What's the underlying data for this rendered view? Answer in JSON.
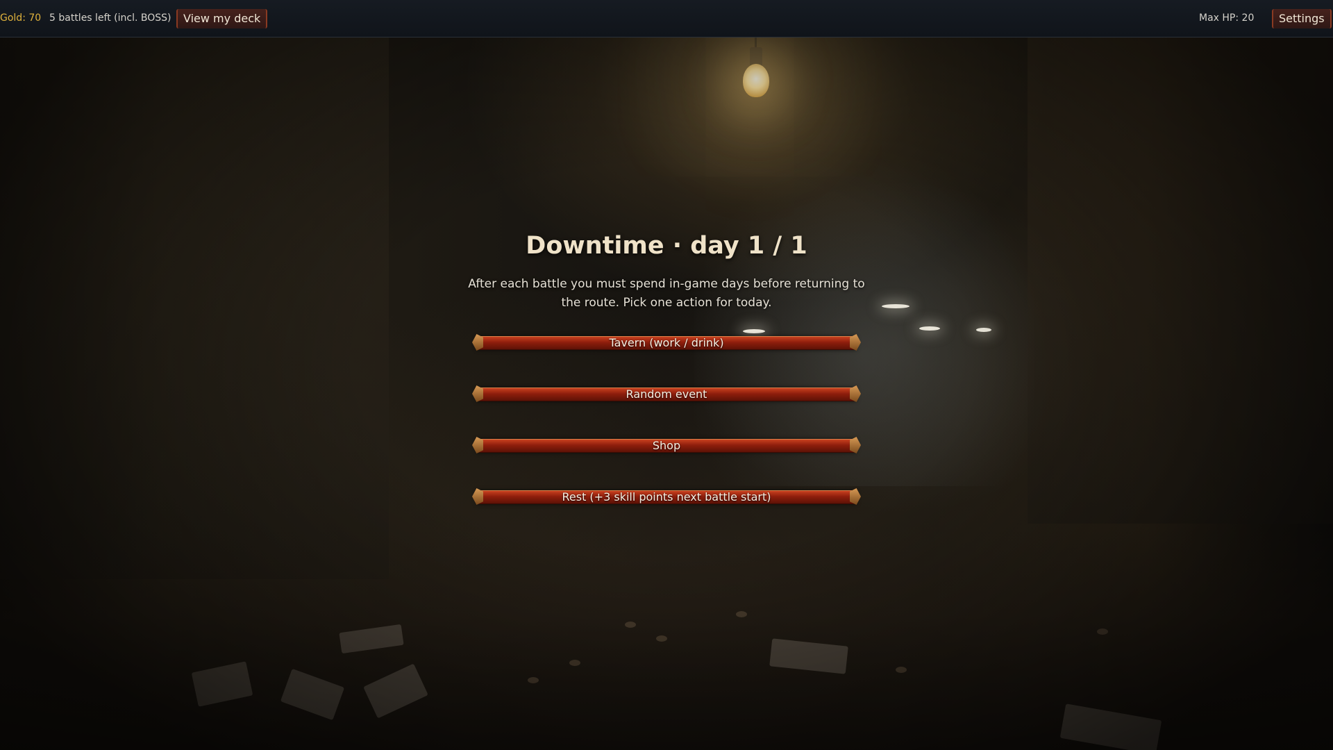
{
  "topbar": {
    "gold": "Gold: 70",
    "battles_left": "5 battles left (incl. BOSS)",
    "view_deck_label": "View my deck",
    "max_hp": "Max HP: 20",
    "settings_label": "Settings"
  },
  "panel": {
    "title": "Downtime · day 1 / 1",
    "description": "After each battle you must spend in-game days before returning to the route. Pick one action for today.",
    "actions": [
      {
        "label": "Tavern (work / drink)"
      },
      {
        "label": "Random event"
      },
      {
        "label": "Shop"
      },
      {
        "label": "Rest (+3 skill points next battle start)"
      }
    ]
  },
  "colors": {
    "gold_text": "#e0b23c",
    "button_red": "#8e1e0c",
    "title_text": "#efe2c8"
  }
}
